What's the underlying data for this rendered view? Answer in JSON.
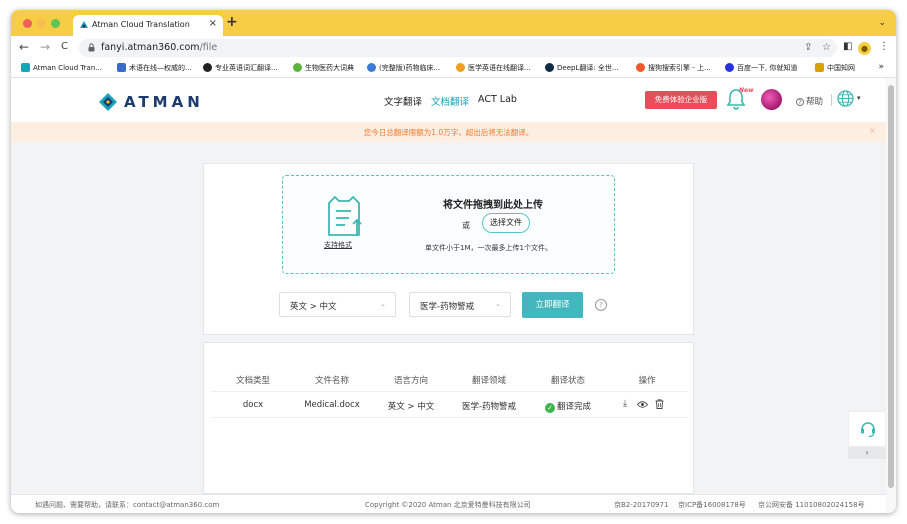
{
  "browser": {
    "tab_title": "Atman Cloud Translation",
    "tab_close": "×",
    "new_tab": "+",
    "tabstrip_menu": "⌄",
    "nav": {
      "back": "←",
      "forward": "→",
      "reload": "C"
    },
    "url_host": "fanyi.atman360.com",
    "url_path": "/file",
    "omnibox_icons": {
      "share": "⇪",
      "star": "☆"
    },
    "toolbar_icons": {
      "sidebar": "◧",
      "menu": "⋮"
    },
    "profile_glyph": "●"
  },
  "bookmarks": {
    "items": [
      {
        "label": "Atman Cloud Tran...",
        "color": "#1aa3b9"
      },
      {
        "label": "术语在线—权威的...",
        "color": "#3a6cc7"
      },
      {
        "label": "专业英语词汇翻译...",
        "color": "#222222"
      },
      {
        "label": "生物医药大词典",
        "color": "#5ab33a"
      },
      {
        "label": "(完整版)药物临床...",
        "color": "#3b7bd8"
      },
      {
        "label": "医学英语在线翻译...",
        "color": "#f0a020"
      },
      {
        "label": "DeepL翻译: 全世...",
        "color": "#0f2b46"
      },
      {
        "label": "搜狗搜索引擎 - 上...",
        "color": "#f05a28"
      },
      {
        "label": "百度一下, 你就知道",
        "color": "#2932e1"
      },
      {
        "label": "中国知网",
        "color": "#d9a000"
      }
    ],
    "more": "»"
  },
  "header": {
    "logo_text": "ATMAN",
    "nav": {
      "text_translate": "文字翻译",
      "doc_translate": "文档翻译",
      "act_lab": "ACT Lab"
    },
    "trial_button": "免费体验企业版",
    "new_badge": "New",
    "help_icon": "?",
    "help": "帮助",
    "lang_caret": "▾"
  },
  "notice": {
    "text": "您今日总翻译限额为1.0万字，超出后将无法翻译。",
    "close": "×"
  },
  "upload": {
    "formats_link": "支持格式",
    "drop_title": "将文件拖拽到此处上传",
    "or": "或",
    "choose_button": "选择文件",
    "hint": "单文件小于1M，一次最多上传1个文件。"
  },
  "controls": {
    "language_select": "英文 > 中文",
    "domain_select": "医学-药物警戒",
    "select_caret": "⌄",
    "translate_button": "立即翻译",
    "info_icon": "?"
  },
  "table": {
    "columns": [
      "文档类型",
      "文件名称",
      "语言方向",
      "翻译领域",
      "翻译状态",
      "操作"
    ],
    "rows": [
      {
        "type": "docx",
        "name": "Medical.docx",
        "direction": "英文 > 中文",
        "domain": "医学-药物警戒",
        "status": "翻译完成",
        "status_icon": "✓"
      }
    ],
    "action_icons": {
      "download": "⤓",
      "view": "◉",
      "delete": "🗑"
    }
  },
  "footer": {
    "contact": "如遇问题、需要帮助，请联系：contact@atman360.com",
    "copyright": "Copyright ©2020 Atman   北京爱特曼科技有限公司",
    "icp1": "京B2-20170971",
    "icp2": "京ICP备16008178号",
    "security": "京公网安备 11010802024158号"
  },
  "side_widget": {
    "chevron": "›"
  },
  "colors": {
    "brand": "#1aa3b9",
    "accent": "#42b7bd",
    "trial": "#e84d5b",
    "notice": "#f17a2a",
    "tabstrip": "#f7cd46"
  }
}
